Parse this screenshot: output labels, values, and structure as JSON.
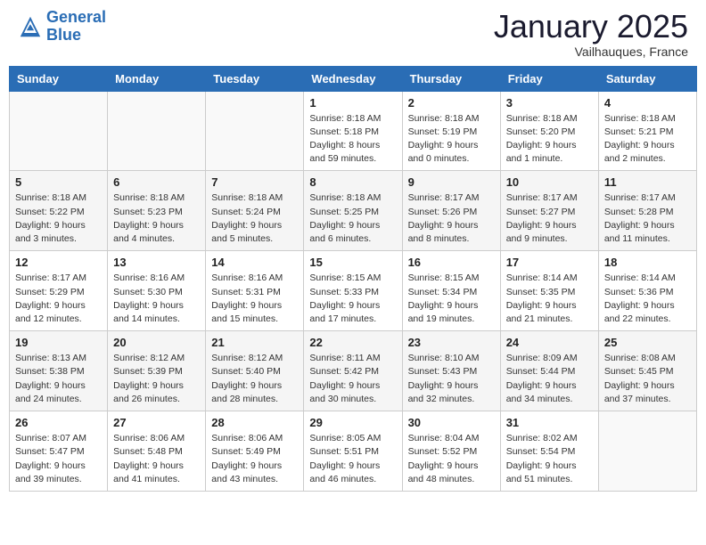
{
  "logo": {
    "line1": "General",
    "line2": "Blue"
  },
  "header": {
    "title": "January 2025",
    "subtitle": "Vailhauques, France"
  },
  "weekdays": [
    "Sunday",
    "Monday",
    "Tuesday",
    "Wednesday",
    "Thursday",
    "Friday",
    "Saturday"
  ],
  "weeks": [
    [
      {
        "day": "",
        "info": ""
      },
      {
        "day": "",
        "info": ""
      },
      {
        "day": "",
        "info": ""
      },
      {
        "day": "1",
        "info": "Sunrise: 8:18 AM\nSunset: 5:18 PM\nDaylight: 8 hours\nand 59 minutes."
      },
      {
        "day": "2",
        "info": "Sunrise: 8:18 AM\nSunset: 5:19 PM\nDaylight: 9 hours\nand 0 minutes."
      },
      {
        "day": "3",
        "info": "Sunrise: 8:18 AM\nSunset: 5:20 PM\nDaylight: 9 hours\nand 1 minute."
      },
      {
        "day": "4",
        "info": "Sunrise: 8:18 AM\nSunset: 5:21 PM\nDaylight: 9 hours\nand 2 minutes."
      }
    ],
    [
      {
        "day": "5",
        "info": "Sunrise: 8:18 AM\nSunset: 5:22 PM\nDaylight: 9 hours\nand 3 minutes."
      },
      {
        "day": "6",
        "info": "Sunrise: 8:18 AM\nSunset: 5:23 PM\nDaylight: 9 hours\nand 4 minutes."
      },
      {
        "day": "7",
        "info": "Sunrise: 8:18 AM\nSunset: 5:24 PM\nDaylight: 9 hours\nand 5 minutes."
      },
      {
        "day": "8",
        "info": "Sunrise: 8:18 AM\nSunset: 5:25 PM\nDaylight: 9 hours\nand 6 minutes."
      },
      {
        "day": "9",
        "info": "Sunrise: 8:17 AM\nSunset: 5:26 PM\nDaylight: 9 hours\nand 8 minutes."
      },
      {
        "day": "10",
        "info": "Sunrise: 8:17 AM\nSunset: 5:27 PM\nDaylight: 9 hours\nand 9 minutes."
      },
      {
        "day": "11",
        "info": "Sunrise: 8:17 AM\nSunset: 5:28 PM\nDaylight: 9 hours\nand 11 minutes."
      }
    ],
    [
      {
        "day": "12",
        "info": "Sunrise: 8:17 AM\nSunset: 5:29 PM\nDaylight: 9 hours\nand 12 minutes."
      },
      {
        "day": "13",
        "info": "Sunrise: 8:16 AM\nSunset: 5:30 PM\nDaylight: 9 hours\nand 14 minutes."
      },
      {
        "day": "14",
        "info": "Sunrise: 8:16 AM\nSunset: 5:31 PM\nDaylight: 9 hours\nand 15 minutes."
      },
      {
        "day": "15",
        "info": "Sunrise: 8:15 AM\nSunset: 5:33 PM\nDaylight: 9 hours\nand 17 minutes."
      },
      {
        "day": "16",
        "info": "Sunrise: 8:15 AM\nSunset: 5:34 PM\nDaylight: 9 hours\nand 19 minutes."
      },
      {
        "day": "17",
        "info": "Sunrise: 8:14 AM\nSunset: 5:35 PM\nDaylight: 9 hours\nand 21 minutes."
      },
      {
        "day": "18",
        "info": "Sunrise: 8:14 AM\nSunset: 5:36 PM\nDaylight: 9 hours\nand 22 minutes."
      }
    ],
    [
      {
        "day": "19",
        "info": "Sunrise: 8:13 AM\nSunset: 5:38 PM\nDaylight: 9 hours\nand 24 minutes."
      },
      {
        "day": "20",
        "info": "Sunrise: 8:12 AM\nSunset: 5:39 PM\nDaylight: 9 hours\nand 26 minutes."
      },
      {
        "day": "21",
        "info": "Sunrise: 8:12 AM\nSunset: 5:40 PM\nDaylight: 9 hours\nand 28 minutes."
      },
      {
        "day": "22",
        "info": "Sunrise: 8:11 AM\nSunset: 5:42 PM\nDaylight: 9 hours\nand 30 minutes."
      },
      {
        "day": "23",
        "info": "Sunrise: 8:10 AM\nSunset: 5:43 PM\nDaylight: 9 hours\nand 32 minutes."
      },
      {
        "day": "24",
        "info": "Sunrise: 8:09 AM\nSunset: 5:44 PM\nDaylight: 9 hours\nand 34 minutes."
      },
      {
        "day": "25",
        "info": "Sunrise: 8:08 AM\nSunset: 5:45 PM\nDaylight: 9 hours\nand 37 minutes."
      }
    ],
    [
      {
        "day": "26",
        "info": "Sunrise: 8:07 AM\nSunset: 5:47 PM\nDaylight: 9 hours\nand 39 minutes."
      },
      {
        "day": "27",
        "info": "Sunrise: 8:06 AM\nSunset: 5:48 PM\nDaylight: 9 hours\nand 41 minutes."
      },
      {
        "day": "28",
        "info": "Sunrise: 8:06 AM\nSunset: 5:49 PM\nDaylight: 9 hours\nand 43 minutes."
      },
      {
        "day": "29",
        "info": "Sunrise: 8:05 AM\nSunset: 5:51 PM\nDaylight: 9 hours\nand 46 minutes."
      },
      {
        "day": "30",
        "info": "Sunrise: 8:04 AM\nSunset: 5:52 PM\nDaylight: 9 hours\nand 48 minutes."
      },
      {
        "day": "31",
        "info": "Sunrise: 8:02 AM\nSunset: 5:54 PM\nDaylight: 9 hours\nand 51 minutes."
      },
      {
        "day": "",
        "info": ""
      }
    ]
  ]
}
